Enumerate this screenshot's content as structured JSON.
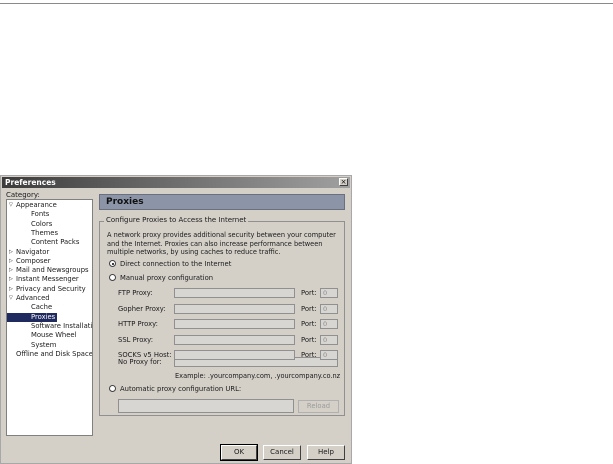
{
  "window": {
    "title": "Preferences",
    "close_glyph": "×"
  },
  "sidebar": {
    "label": "Category:",
    "items": [
      {
        "label": "Appearance",
        "level": 0,
        "twisty": "open"
      },
      {
        "label": "Fonts",
        "level": 1
      },
      {
        "label": "Colors",
        "level": 1
      },
      {
        "label": "Themes",
        "level": 1
      },
      {
        "label": "Content Packs",
        "level": 1
      },
      {
        "label": "Navigator",
        "level": 0,
        "twisty": "closed"
      },
      {
        "label": "Composer",
        "level": 0,
        "twisty": "closed"
      },
      {
        "label": "Mail and Newsgroups",
        "level": 0,
        "twisty": "closed"
      },
      {
        "label": "Instant Messenger",
        "level": 0,
        "twisty": "closed"
      },
      {
        "label": "Privacy and Security",
        "level": 0,
        "twisty": "closed"
      },
      {
        "label": "Advanced",
        "level": 0,
        "twisty": "open"
      },
      {
        "label": "Cache",
        "level": 1
      },
      {
        "label": "Proxies",
        "level": 1,
        "selected": true
      },
      {
        "label": "Software Installati...",
        "level": 1
      },
      {
        "label": "Mouse Wheel",
        "level": 1
      },
      {
        "label": "System",
        "level": 1
      },
      {
        "label": "Offline and Disk Space",
        "level": 0
      }
    ]
  },
  "panel": {
    "title": "Proxies",
    "group_title": "Configure Proxies to Access the Internet",
    "description": "A network proxy provides additional security between your computer and the Internet. Proxies can also increase performance between multiple networks, by using caches to reduce traffic.",
    "direct_label": "Direct connection to the Internet",
    "manual_label": "Manual proxy configuration",
    "proxies": [
      {
        "label": "FTP Proxy:",
        "port_label": "Port:",
        "port_value": "0",
        "value": ""
      },
      {
        "label": "Gopher Proxy:",
        "port_label": "Port:",
        "port_value": "0",
        "value": ""
      },
      {
        "label": "HTTP Proxy:",
        "port_label": "Port:",
        "port_value": "0",
        "value": ""
      },
      {
        "label": "SSL Proxy:",
        "port_label": "Port:",
        "port_value": "0",
        "value": ""
      },
      {
        "label": "SOCKS v5 Host:",
        "port_label": "Port:",
        "port_value": "0",
        "value": ""
      }
    ],
    "no_proxy_label": "No Proxy for:",
    "no_proxy_value": "",
    "example": "Example: .yourcompany.com, .yourcompany.co.nz",
    "auto_label": "Automatic proxy configuration URL:",
    "auto_value": "",
    "reload_label": "Reload",
    "selected_option": "direct"
  },
  "footer": {
    "ok": "OK",
    "cancel": "Cancel",
    "help": "Help"
  },
  "colors": {
    "dialog_bg": "#d4d0c8",
    "selection": "#1f2a5e",
    "header_bg": "#8c95a8"
  }
}
